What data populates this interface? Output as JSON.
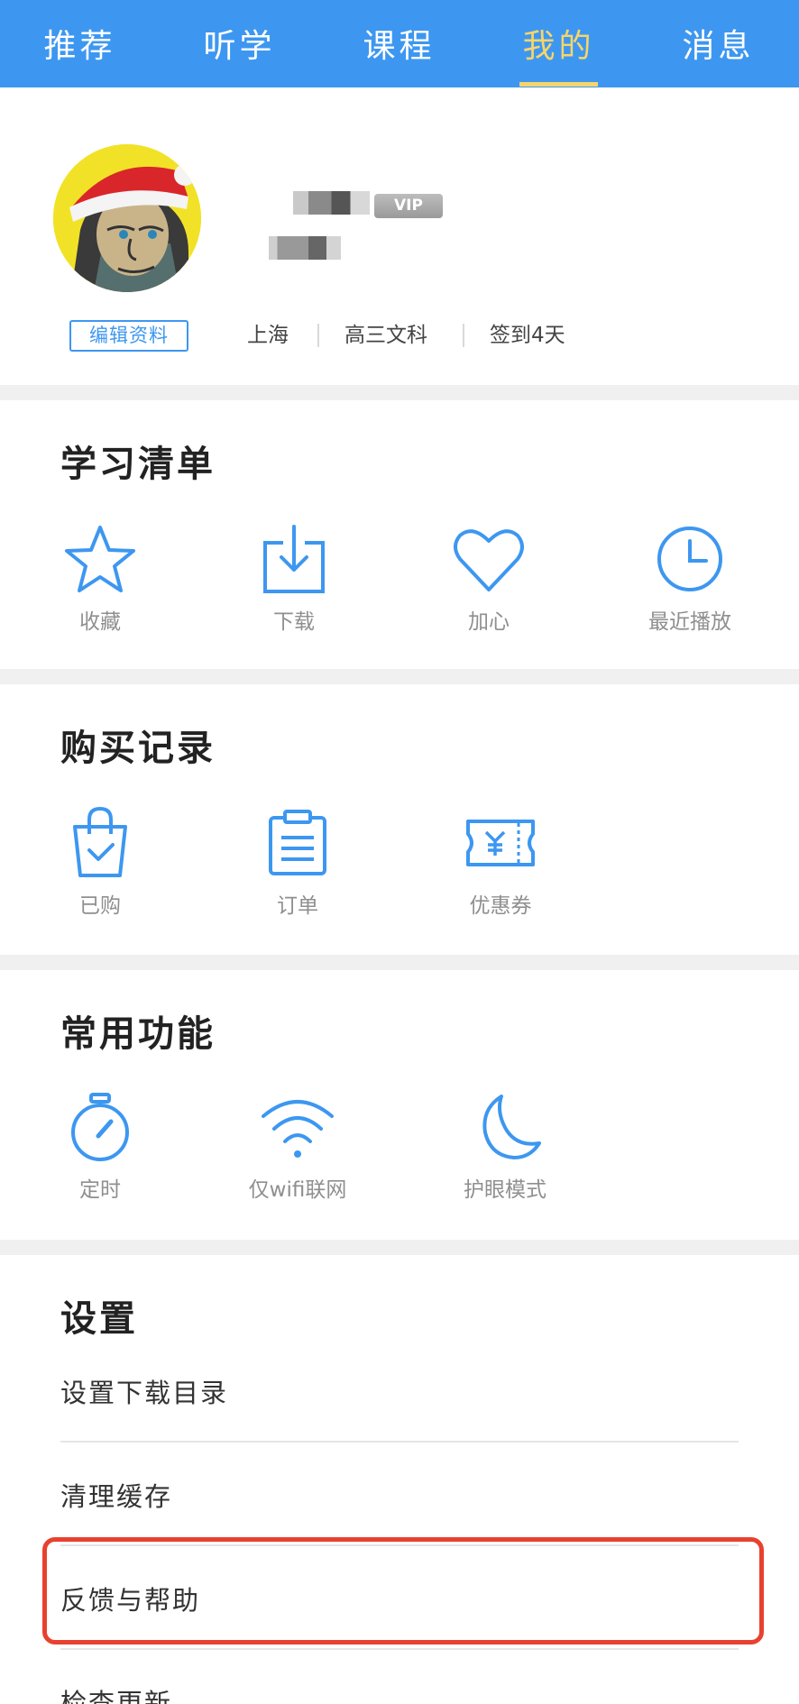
{
  "tabs": [
    {
      "label": "推荐"
    },
    {
      "label": "听学"
    },
    {
      "label": "课程"
    },
    {
      "label": "我的",
      "active": true
    },
    {
      "label": "消息"
    }
  ],
  "profile": {
    "vip_badge": "VIP",
    "edit_label": "编辑资料",
    "location": "上海",
    "grade": "高三文科",
    "checkin": "签到4天"
  },
  "study_list": {
    "title": "学习清单",
    "items": [
      {
        "label": "收藏",
        "icon": "star-icon"
      },
      {
        "label": "下载",
        "icon": "download-icon"
      },
      {
        "label": "加心",
        "icon": "heart-icon"
      },
      {
        "label": "最近播放",
        "icon": "clock-icon"
      }
    ]
  },
  "purchase": {
    "title": "购买记录",
    "items": [
      {
        "label": "已购",
        "icon": "shopping-bag-icon"
      },
      {
        "label": "订单",
        "icon": "order-list-icon"
      },
      {
        "label": "优惠券",
        "icon": "coupon-icon"
      }
    ]
  },
  "functions": {
    "title": "常用功能",
    "items": [
      {
        "label": "定时",
        "icon": "timer-icon"
      },
      {
        "label": "仅wifi联网",
        "icon": "wifi-icon"
      },
      {
        "label": "护眼模式",
        "icon": "moon-icon"
      }
    ]
  },
  "settings": {
    "title": "设置",
    "rows": [
      {
        "label": "设置下载目录"
      },
      {
        "label": "清理缓存"
      },
      {
        "label": "反馈与帮助"
      },
      {
        "label": "检查更新"
      }
    ]
  },
  "colors": {
    "accent": "#3d97f0",
    "active_tab": "#f7d56a",
    "highlight": "#e8412f"
  }
}
